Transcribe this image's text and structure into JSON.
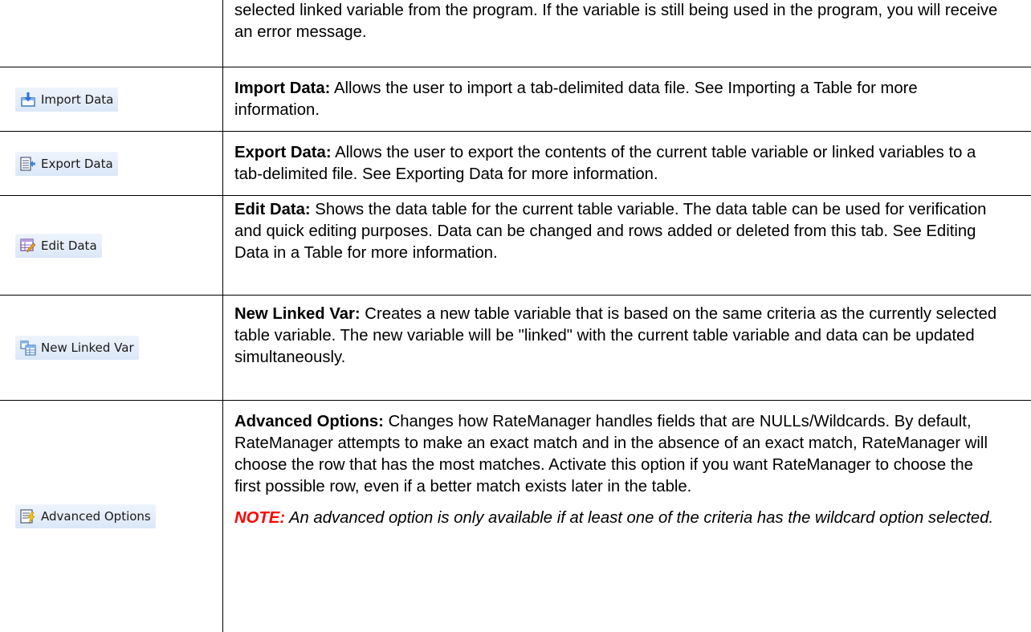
{
  "rows": [
    {
      "button_label": "",
      "description": "selected linked variable from the program. If the variable is still being used in the program, you will receive an error message."
    },
    {
      "button_label": "Import Data",
      "icon": "import-data-icon",
      "term": "Import Data:",
      "description": " Allows the user to import a tab-delimited data file. See Importing a Table for more information."
    },
    {
      "button_label": "Export Data",
      "icon": "export-data-icon",
      "term": "Export Data:",
      "description": " Allows the user to export the contents of the current table variable or linked variables to a tab-delimited file. See Exporting Data for more information."
    },
    {
      "button_label": "Edit Data",
      "icon": "edit-data-icon",
      "term": "Edit Data:",
      "description": " Shows the data table for the current table variable. The data table can be used for verification and quick editing purposes. Data can be changed and rows added or deleted from this tab. See Editing Data in a Table for more information."
    },
    {
      "button_label": "New Linked Var",
      "icon": "new-linked-var-icon",
      "term": "New Linked Var:",
      "description": " Creates a new table variable that is based on the same criteria as the currently selected table variable. The new variable will be \"linked\" with the current table variable and data can be updated simultaneously."
    },
    {
      "button_label": "Advanced Options",
      "icon": "advanced-options-icon",
      "term": "Advanced Options:",
      "description": " Changes how RateManager handles fields that are NULLs/Wildcards. By default, RateManager attempts to make an exact match and in the absence of an exact match, RateManager will choose the row that has the most matches. Activate this option if you want RateManager to choose the first possible row, even if a better match exists later in the table.",
      "note_label": "NOTE:",
      "note_text": " An advanced option is only available if at least one of the criteria has the wildcard option selected."
    }
  ],
  "colors": {
    "button_gradient_top": "#eef4fd",
    "button_gradient_bottom": "#dbe7f8",
    "note_label": "#ff0000",
    "border": "#000000"
  }
}
